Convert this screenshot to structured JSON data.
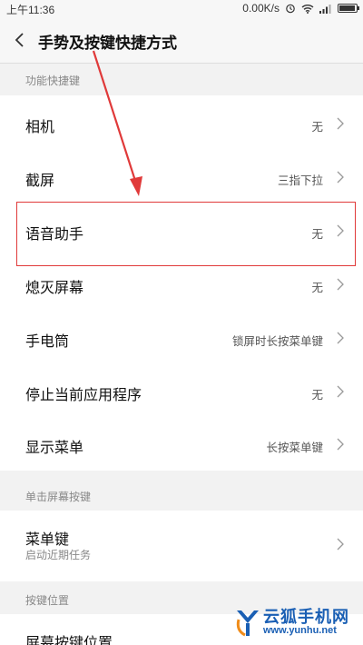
{
  "status_bar": {
    "time": "上午11:36",
    "net_speed": "0.00K/s"
  },
  "header": {
    "title": "手势及按键快捷方式"
  },
  "sections": [
    {
      "header": "功能快捷键",
      "items": [
        {
          "label": "相机",
          "value": "无"
        },
        {
          "label": "截屏",
          "value": "三指下拉"
        },
        {
          "label": "语音助手",
          "value": "无"
        },
        {
          "label": "熄灭屏幕",
          "value": "无"
        },
        {
          "label": "手电筒",
          "value": "锁屏时长按菜单键"
        },
        {
          "label": "停止当前应用程序",
          "value": "无"
        },
        {
          "label": "显示菜单",
          "value": "长按菜单键"
        }
      ]
    },
    {
      "header": "单击屏幕按键",
      "items": [
        {
          "label": "菜单键",
          "subtitle": "启动近期任务"
        }
      ]
    },
    {
      "header": "按键位置",
      "items": [
        {
          "label": "屏幕按键位置"
        }
      ]
    }
  ],
  "watermark": {
    "name": "云狐手机网",
    "url": "www.yunhu.net"
  },
  "colors": {
    "annotation": "#e03a3a",
    "watermark": "#1a5fb4"
  },
  "icons": [
    "alarm-icon",
    "wifi-icon",
    "signal-icon",
    "battery-icon",
    "back-arrow-icon",
    "chevron-right-icon"
  ]
}
